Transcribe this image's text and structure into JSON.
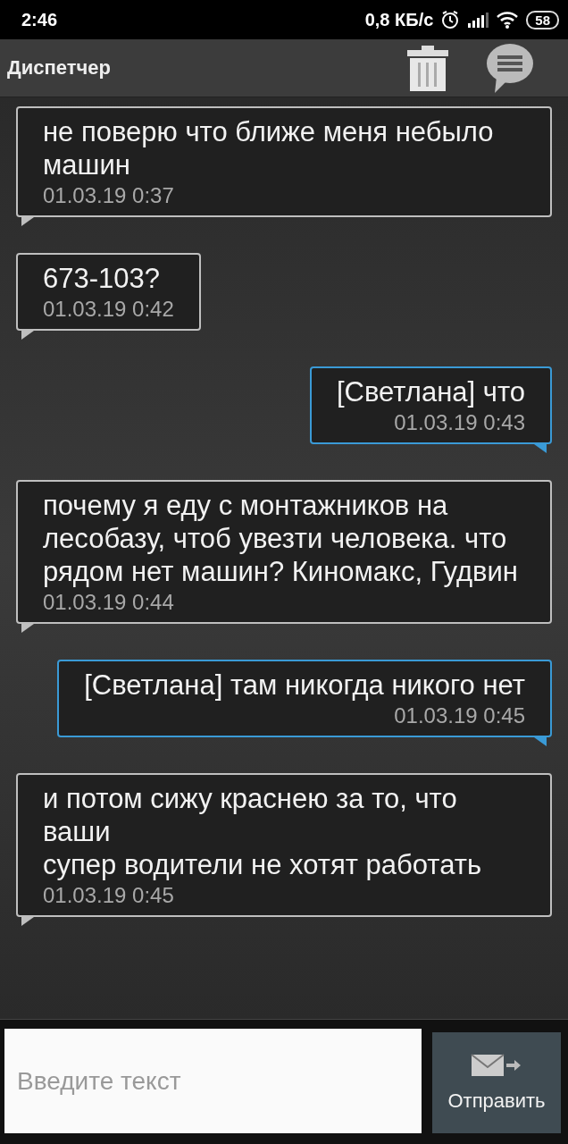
{
  "status_bar": {
    "time": "2:46",
    "speed": "0,8 КБ/с",
    "battery": "58"
  },
  "header": {
    "title": "Диспетчер"
  },
  "messages": [
    {
      "kind": "incoming",
      "text": "не поверю что ближе меня небыло машин",
      "time": "01.03.19 0:37"
    },
    {
      "kind": "incoming",
      "text": "673-103?",
      "time": "01.03.19 0:42"
    },
    {
      "kind": "outgoing",
      "text": "[Светлана] что",
      "time": "01.03.19 0:43"
    },
    {
      "kind": "incoming",
      "text": "почему я еду с монтажников на лесобазу, чтоб увезти человека. что рядом нет машин? Киномакс, Гудвин",
      "time": "01.03.19 0:44"
    },
    {
      "kind": "outgoing",
      "text": "[Светлана] там никогда никого нет",
      "time": "01.03.19 0:45"
    },
    {
      "kind": "incoming",
      "text": "и потом сижу краснею за то, что ваши\nсупер водители не хотят работать",
      "time": "01.03.19 0:45"
    }
  ],
  "composer": {
    "placeholder": "Введите текст",
    "send_label": "Отправить"
  }
}
